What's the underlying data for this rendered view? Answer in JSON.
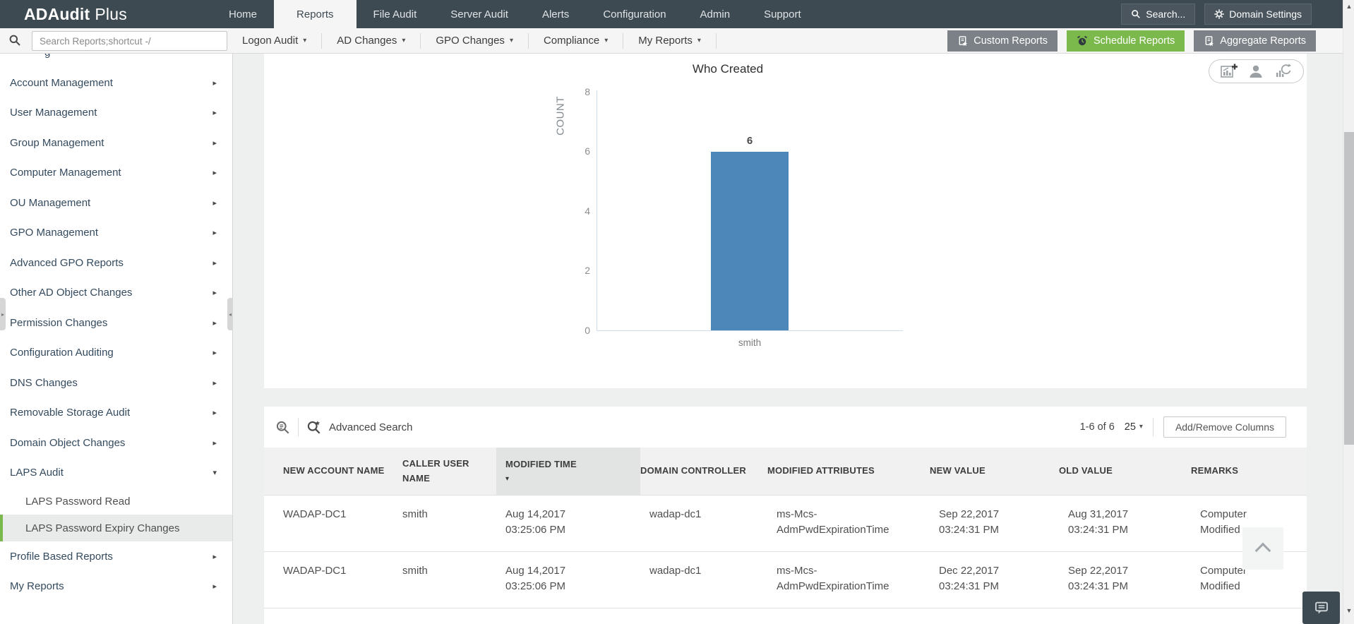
{
  "brand": {
    "name_bold": "ADAudit",
    "name_light": "Plus"
  },
  "topnav": {
    "items": [
      {
        "label": "Home"
      },
      {
        "label": "Reports",
        "active": true
      },
      {
        "label": "File Audit"
      },
      {
        "label": "Server Audit"
      },
      {
        "label": "Alerts"
      },
      {
        "label": "Configuration"
      },
      {
        "label": "Admin"
      },
      {
        "label": "Support"
      }
    ],
    "search_button": "Search...",
    "domain_settings_button": "Domain Settings"
  },
  "toolbar": {
    "search_placeholder": "Search Reports;shortcut -/",
    "menus": [
      {
        "label": "Logon Audit"
      },
      {
        "label": "AD Changes"
      },
      {
        "label": "GPO Changes"
      },
      {
        "label": "Compliance"
      },
      {
        "label": "My Reports"
      }
    ],
    "actions": [
      {
        "label": "Custom Reports",
        "variant": "gray"
      },
      {
        "label": "Schedule Reports",
        "variant": "green"
      },
      {
        "label": "Aggregate Reports",
        "variant": "gray"
      }
    ]
  },
  "sidebar": {
    "clipped_fragment": "g",
    "items": [
      {
        "label": "Account Management"
      },
      {
        "label": "User Management"
      },
      {
        "label": "Group Management"
      },
      {
        "label": "Computer Management"
      },
      {
        "label": "OU Management"
      },
      {
        "label": "GPO Management"
      },
      {
        "label": "Advanced GPO Reports"
      },
      {
        "label": "Other AD Object Changes"
      },
      {
        "label": "Permission Changes"
      },
      {
        "label": "Configuration Auditing"
      },
      {
        "label": "DNS Changes"
      },
      {
        "label": "Removable Storage Audit"
      },
      {
        "label": "Domain Object Changes"
      },
      {
        "label": "LAPS Audit",
        "expanded": true,
        "children": [
          {
            "label": "LAPS Password Read"
          },
          {
            "label": "LAPS Password Expiry Changes",
            "selected": true
          }
        ]
      },
      {
        "label": "Profile Based Reports"
      },
      {
        "label": "My Reports"
      }
    ]
  },
  "chart_data": {
    "type": "bar",
    "title": "Who Created",
    "ylabel": "COUNT",
    "xlabel": "",
    "categories": [
      "smith"
    ],
    "values": [
      6
    ],
    "ylim": [
      0,
      8
    ],
    "yticks": [
      8,
      6,
      4,
      2,
      0
    ],
    "grid": false,
    "legend": "none",
    "bar_color": "#4d87ba"
  },
  "table": {
    "advanced_search_label": "Advanced Search",
    "pagination": "1-6 of 6",
    "page_size": "25",
    "add_remove_columns_label": "Add/Remove Columns",
    "sort": {
      "column": "MODIFIED TIME",
      "direction": "desc"
    },
    "columns": [
      "NEW ACCOUNT NAME",
      "CALLER USER NAME",
      "MODIFIED TIME",
      "DOMAIN CONTROLLER",
      "MODIFIED ATTRIBUTES",
      "NEW VALUE",
      "OLD VALUE",
      "REMARKS"
    ],
    "rows": [
      [
        "WADAP-DC1",
        "smith",
        "Aug 14,2017 03:25:06 PM",
        "wadap-dc1",
        "ms-Mcs-AdmPwdExpirationTime",
        "Sep 22,2017 03:24:31 PM",
        "Aug 31,2017 03:24:31 PM",
        "Computer Modified"
      ],
      [
        "WADAP-DC1",
        "smith",
        "Aug 14,2017 03:25:06 PM",
        "wadap-dc1",
        "ms-Mcs-AdmPwdExpirationTime",
        "Dec 22,2017 03:24:31 PM",
        "Sep 22,2017 03:24:31 PM",
        "Computer Modified"
      ]
    ]
  },
  "icons": {
    "caret_down": "▾",
    "arrow_right": "▸",
    "scroll_up": "▲",
    "scroll_down": "▼",
    "handle_left": "◂",
    "handle_right": "▸"
  },
  "colors": {
    "nav_dark": "#3e4a52",
    "accent_green": "#7cb94c",
    "bar_blue": "#4d87ba"
  }
}
